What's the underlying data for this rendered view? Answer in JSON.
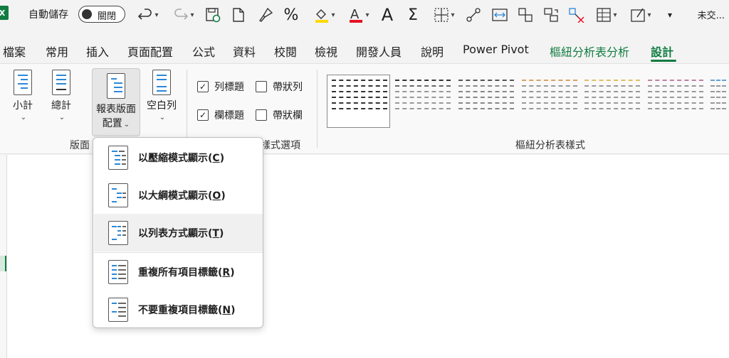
{
  "titlebar": {
    "autosave_label": "自動儲存",
    "autosave_state": "關閉",
    "right_text": "未交..."
  },
  "tabs": [
    {
      "label": "檔案"
    },
    {
      "label": "常用"
    },
    {
      "label": "插入"
    },
    {
      "label": "頁面配置"
    },
    {
      "label": "公式"
    },
    {
      "label": "資料"
    },
    {
      "label": "校閱"
    },
    {
      "label": "檢視"
    },
    {
      "label": "開發人員"
    },
    {
      "label": "說明"
    },
    {
      "label": "Power Pivot"
    },
    {
      "label": "樞紐分析表分析"
    },
    {
      "label": "設計"
    }
  ],
  "ribbon": {
    "layout": {
      "subtotal": "小計",
      "grand_total": "總計",
      "report_layout_line1": "報表版面",
      "report_layout_line2": "配置",
      "blank_rows": "空白列",
      "group_label": "版面"
    },
    "style_options": {
      "row_headers": "列標題",
      "column_headers": "欄標題",
      "banded_rows": "帶狀列",
      "banded_columns": "帶狀欄",
      "group_label": "樣式選項"
    },
    "pivot_styles": {
      "group_label": "樞紐分析表樣式"
    }
  },
  "menu": {
    "items": [
      {
        "text": "以壓縮模式顯示(",
        "key": "C",
        "close": ")"
      },
      {
        "text": "以大綱模式顯示(",
        "key": "O",
        "close": ")"
      },
      {
        "text": "以列表方式顯示(",
        "key": "T",
        "close": ")"
      },
      {
        "text": "重複所有項目標籤(",
        "key": "R",
        "close": ")"
      },
      {
        "text": "不要重複項目標籤(",
        "key": "N",
        "close": ")"
      }
    ]
  },
  "colors": {
    "accent": "#107c41",
    "icon_blue": "#2b88d8"
  }
}
